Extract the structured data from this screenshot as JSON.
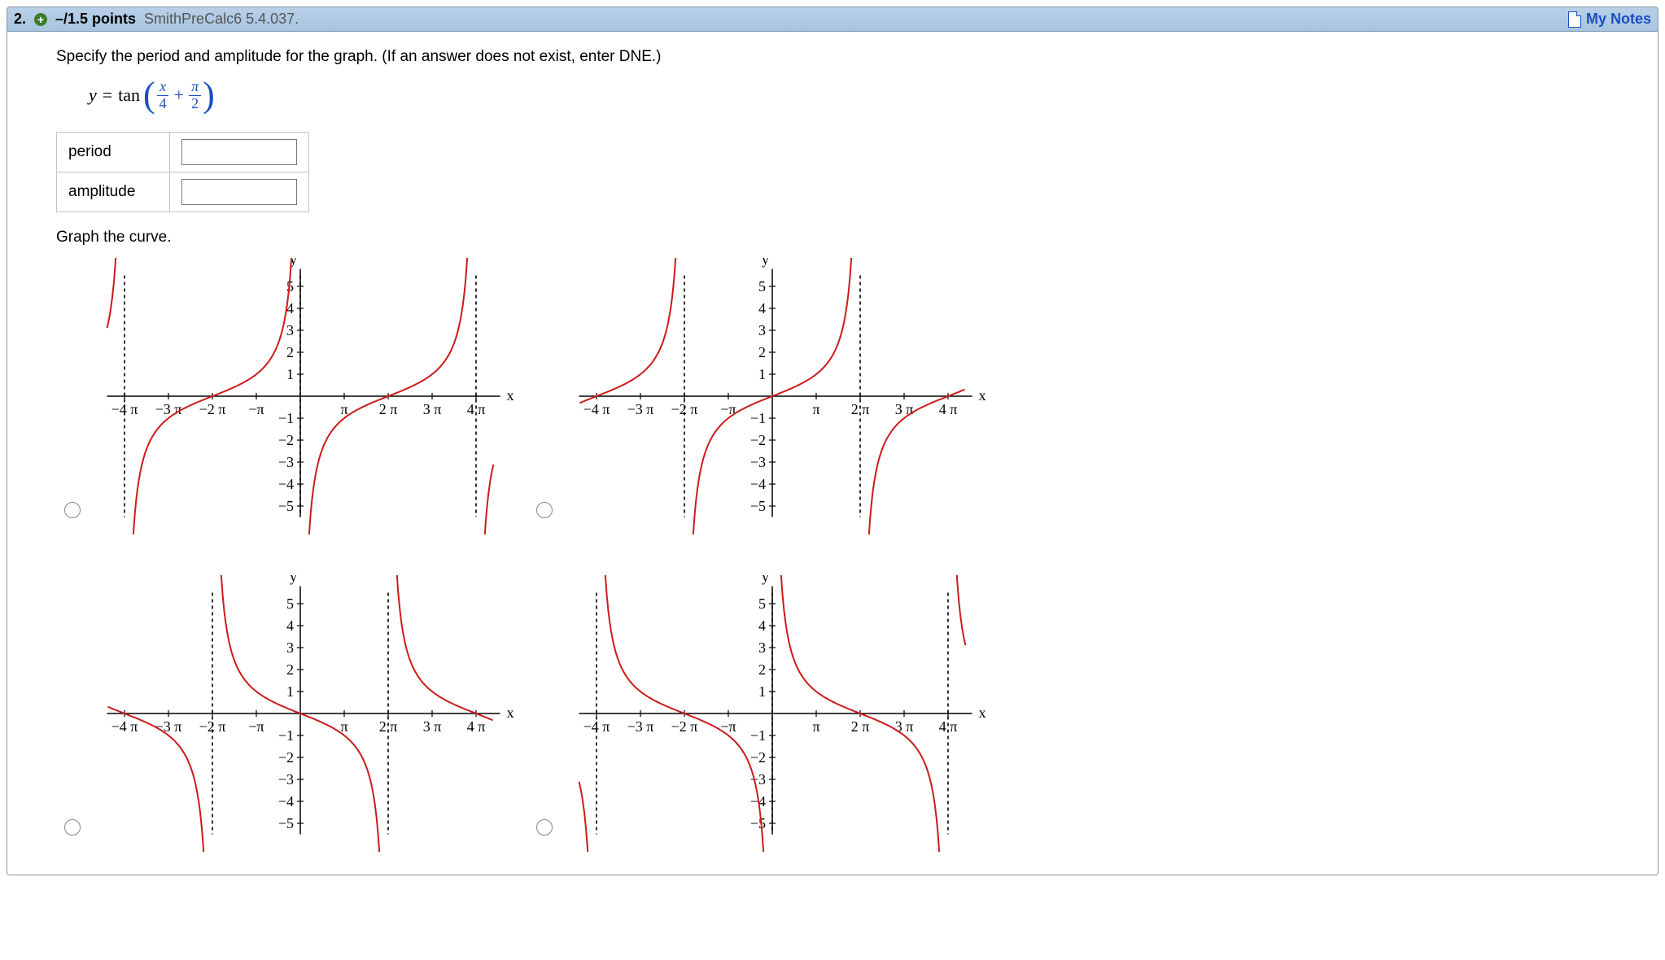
{
  "header": {
    "qnum": "2.",
    "points": "–/1.5 points",
    "source": "SmithPreCalc6 5.4.037.",
    "my_notes": "My Notes"
  },
  "instruction": "Specify the period and amplitude for the graph. (If an answer does not exist, enter DNE.)",
  "equation": {
    "lead": "y = ",
    "fn": "tan",
    "frac1_num": "x",
    "frac1_den": "4",
    "frac2_num": "π",
    "frac2_den": "2"
  },
  "fields": {
    "period_label": "period",
    "amplitude_label": "amplitude"
  },
  "graph_instruction": "Graph the curve.",
  "chart_data": [
    {
      "type": "line",
      "title": "",
      "xlabel": "x",
      "ylabel": "y",
      "x_ticks": [
        "−4 π",
        "−3 π",
        "−2 π",
        "−π",
        "π",
        "2 π",
        "3 π",
        "4 π"
      ],
      "y_ticks": [
        -5,
        -4,
        -3,
        -2,
        -1,
        1,
        2,
        3,
        4,
        5
      ],
      "xlim": [
        -4.4,
        4.4
      ],
      "ylim": [
        -5.5,
        5.5
      ],
      "function": "tan(x/4 + pi/2)  (period 4π, asymptotes at x = -4π, 0, 4π)",
      "asymptotes_pi": [
        -4,
        0,
        4
      ]
    },
    {
      "type": "line",
      "title": "",
      "xlabel": "x",
      "ylabel": "y",
      "x_ticks": [
        "−4 π",
        "−3 π",
        "−2 π",
        "−π",
        "π",
        "2 π",
        "3 π",
        "4 π"
      ],
      "y_ticks": [
        -5,
        -4,
        -3,
        -2,
        -1,
        1,
        2,
        3,
        4,
        5
      ],
      "xlim": [
        -4.4,
        4.4
      ],
      "ylim": [
        -5.5,
        5.5
      ],
      "function": "tan(x/4)  (period 4π, asymptotes at x = -2π, 2π)",
      "asymptotes_pi": [
        -2,
        2
      ]
    },
    {
      "type": "line",
      "title": "",
      "xlabel": "x",
      "ylabel": "y",
      "x_ticks": [
        "−4 π",
        "−3 π",
        "−2 π",
        "−π",
        "π",
        "2 π",
        "3 π",
        "4 π"
      ],
      "y_ticks": [
        -5,
        -4,
        -3,
        -2,
        -1,
        1,
        2,
        3,
        4,
        5
      ],
      "xlim": [
        -4.4,
        4.4
      ],
      "ylim": [
        -5.5,
        5.5
      ],
      "function": "-tan(x/4)  (period 4π, asymptotes at x = -2π, 2π)",
      "asymptotes_pi": [
        -2,
        2
      ]
    },
    {
      "type": "line",
      "title": "",
      "xlabel": "x",
      "ylabel": "y",
      "x_ticks": [
        "−4 π",
        "−3 π",
        "−2 π",
        "−π",
        "π",
        "2 π",
        "3 π",
        "4 π"
      ],
      "y_ticks": [
        -5,
        -4,
        -3,
        -2,
        -1,
        1,
        2,
        3,
        4,
        5
      ],
      "xlim": [
        -4.4,
        4.4
      ],
      "ylim": [
        -5.5,
        5.5
      ],
      "function": "-tan(x/4 + pi/2)  (period 4π, asymptotes at x = -4π, 0, 4π)",
      "asymptotes_pi": [
        -4,
        0,
        4
      ]
    }
  ]
}
